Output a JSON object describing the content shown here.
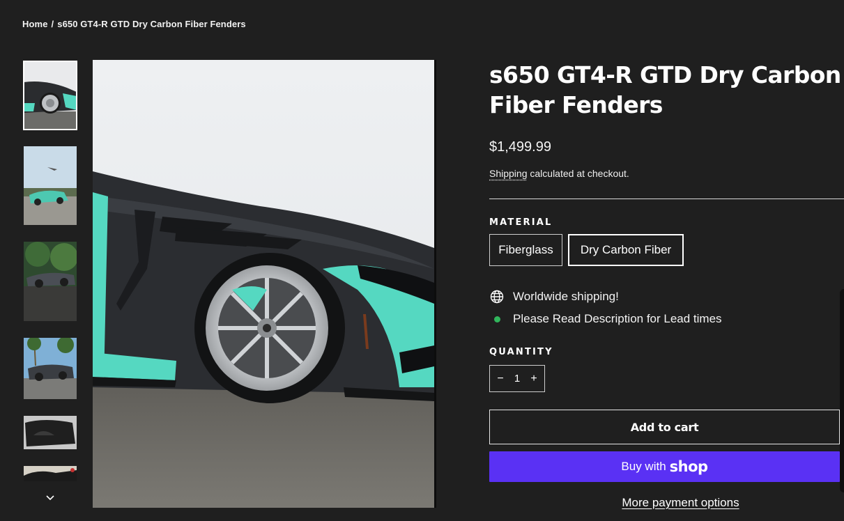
{
  "breadcrumb": {
    "home": "Home",
    "separator": "/",
    "current": "s650 GT4-R GTD Dry Carbon Fiber Fenders"
  },
  "gallery": {
    "thumbnail_count": 6,
    "active_index": 0,
    "scroll_icon": "chevron-down-icon"
  },
  "product": {
    "title": "s650 GT4-R GTD Dry Carbon Fiber Fenders",
    "price": "$1,499.99",
    "shipping_link": "Shipping",
    "shipping_rest": " calculated at checkout."
  },
  "material": {
    "label": "MATERIAL",
    "options": [
      "Fiberglass",
      "Dry Carbon Fiber"
    ],
    "selected": "Dry Carbon Fiber"
  },
  "features": {
    "worldwide": {
      "icon": "globe-icon",
      "text": "Worldwide shipping!"
    },
    "lead_times": {
      "icon": "status-dot-icon",
      "text": "Please Read Description for Lead times",
      "color": "#31b65c"
    }
  },
  "quantity": {
    "label": "QUANTITY",
    "minus": "−",
    "value": "1",
    "plus": "+"
  },
  "buttons": {
    "add_to_cart": "Add to cart",
    "buy_with": "Buy with",
    "shop": "shop",
    "more_payment": "More payment options"
  },
  "colors": {
    "background": "#1f1f1f",
    "shop_pay": "#5a31f4",
    "car_accent": "#55d8c1"
  }
}
